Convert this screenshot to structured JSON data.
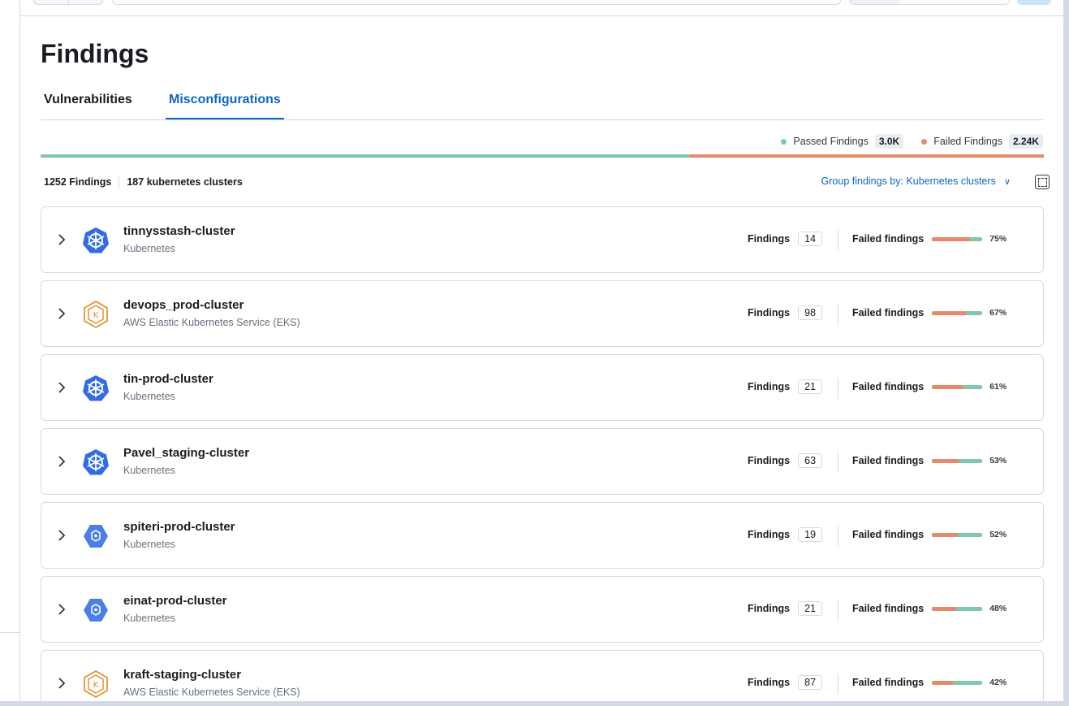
{
  "query_bar": {
    "quote_glyph": "”"
  },
  "page": {
    "title": "Findings"
  },
  "tabs": [
    {
      "label": "Vulnerabilities",
      "active": false
    },
    {
      "label": "Misconfigurations",
      "active": true
    }
  ],
  "legend": {
    "passed_label": "Passed Findings",
    "passed_count": "3.0K",
    "failed_label": "Failed Findings",
    "failed_count": "2.24K",
    "passed_fraction": 0.6475
  },
  "summary": {
    "findings": "1252 Findings",
    "clusters": "187 kubernetes clusters"
  },
  "group_by": {
    "label": "Group findings by: Kubernetes clusters",
    "chevron": "∨"
  },
  "labels": {
    "findings": "Findings",
    "failed_findings": "Failed findings"
  },
  "colors": {
    "passed": "#7fc8ae",
    "failed": "#e7896c",
    "accent": "#0f66c2"
  },
  "clusters": [
    {
      "name": "tinnysstash-cluster",
      "type": "Kubernetes",
      "icon": "kubernetes-helm-icon",
      "findings": "14",
      "failed_pct": "75%",
      "failed_fraction": 0.75
    },
    {
      "name": "devops_prod-cluster",
      "type": "AWS Elastic Kubernetes Service (EKS)",
      "icon": "aws-eks-icon",
      "findings": "98",
      "failed_pct": "67%",
      "failed_fraction": 0.67
    },
    {
      "name": "tin-prod-cluster",
      "type": "Kubernetes",
      "icon": "kubernetes-helm-icon",
      "findings": "21",
      "failed_pct": "61%",
      "failed_fraction": 0.61
    },
    {
      "name": "Pavel_staging-cluster",
      "type": "Kubernetes",
      "icon": "kubernetes-helm-icon",
      "findings": "63",
      "failed_pct": "53%",
      "failed_fraction": 0.53
    },
    {
      "name": "spiteri-prod-cluster",
      "type": "Kubernetes",
      "icon": "gke-icon",
      "findings": "19",
      "failed_pct": "52%",
      "failed_fraction": 0.52
    },
    {
      "name": "einat-prod-cluster",
      "type": "Kubernetes",
      "icon": "gke-icon",
      "findings": "21",
      "failed_pct": "48%",
      "failed_fraction": 0.48
    },
    {
      "name": "kraft-staging-cluster",
      "type": "AWS Elastic Kubernetes Service (EKS)",
      "icon": "aws-eks-icon",
      "findings": "87",
      "failed_pct": "42%",
      "failed_fraction": 0.42
    }
  ]
}
